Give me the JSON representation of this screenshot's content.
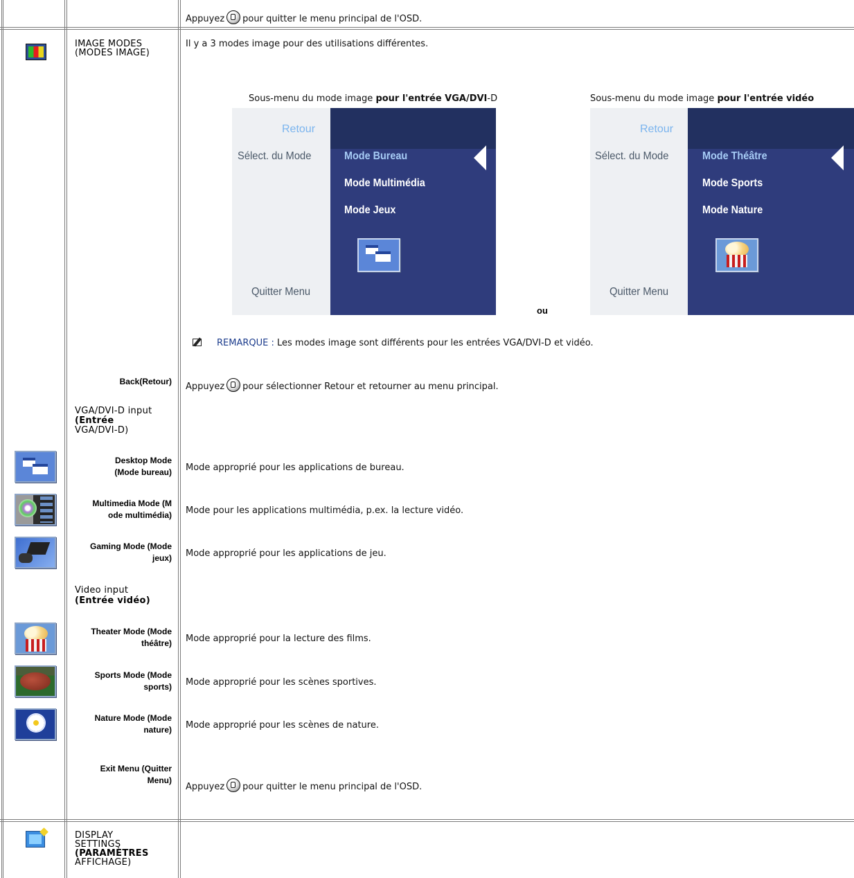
{
  "row_prev": {
    "exit_text_before": "Appuyez",
    "exit_text_after": "pour quitter le menu principal de l'OSD."
  },
  "image_modes": {
    "heading_line1": "IMAGE MODES",
    "heading_line2": "(MODES IMAGE)",
    "intro": "Il y a 3 modes image pour des utilisations différentes.",
    "caption_left_plain": "Sous-menu du mode image ",
    "caption_left_bold": "pour l'entrée VGA/DVI",
    "caption_left_tail": "-D",
    "caption_right_plain": "Sous-menu du mode image ",
    "caption_right_bold": "pour l'entrée vidéo",
    "or_label": "ou",
    "osd_left": {
      "back": "Retour",
      "select": "Sélect. du Mode",
      "items": [
        "Mode Bureau",
        "Mode Multimédia",
        "Mode Jeux"
      ],
      "exit": "Quitter Menu"
    },
    "osd_right": {
      "back": "Retour",
      "select": "Sélect. du Mode",
      "items": [
        "Mode Théâtre",
        "Mode Sports",
        "Mode Nature"
      ],
      "exit": "Quitter Menu"
    },
    "note_label": "REMARQUE :",
    "note_text": " Les modes image sont différents pour les entrées VGA/DVI-D et vidéo."
  },
  "rows": {
    "back": {
      "label": "Back(Retour)",
      "before": "Appuyez",
      "after": "pour sélectionner Retour et retourner au menu principal."
    },
    "vga_heading": {
      "line1": "VGA/DVI-D input",
      "line2": "(Entrée",
      "line3": "VGA/DVI-D)"
    },
    "desktop": {
      "label1": "Desktop Mode",
      "label2": "(Mode bureau)",
      "desc": "Mode approprié pour les applications de bureau."
    },
    "multimedia": {
      "label1": "Multimedia Mode (M",
      "label2": "ode multimédia)",
      "desc": "Mode pour les applications multimédia, p.ex. la lecture vidéo."
    },
    "gaming": {
      "label1": "Gaming Mode (Mode",
      "label2": "jeux)",
      "desc": "Mode approprié pour les applications de jeu."
    },
    "video_heading": {
      "line1": "Video input",
      "line2": "(Entrée vidéo)"
    },
    "theater": {
      "label1": "Theater Mode (Mode",
      "label2": "théâtre)",
      "desc": "Mode approprié pour la lecture des films."
    },
    "sports": {
      "label1": "Sports Mode (Mode",
      "label2": "sports)",
      "desc": "Mode approprié pour les scènes sportives."
    },
    "nature": {
      "label1": "Nature Mode (Mode",
      "label2": "nature)",
      "desc": "Mode approprié pour les scènes de nature."
    },
    "exit": {
      "label1": "Exit Menu (Quitter",
      "label2": "Menu)",
      "before": "Appuyez",
      "after": "pour quitter le menu principal de l'OSD."
    }
  },
  "display_settings": {
    "line1": "DISPLAY",
    "line2": "SETTINGS",
    "line3": "(PARAMÈTRES",
    "line4": "AFFICHAGE)"
  },
  "colors": {
    "osd_panel_blue": "#2f3c7c",
    "osd_header_blue": "#223060",
    "osd_panel_light": "#eef0f3",
    "note_label": "#1b3b8c"
  }
}
